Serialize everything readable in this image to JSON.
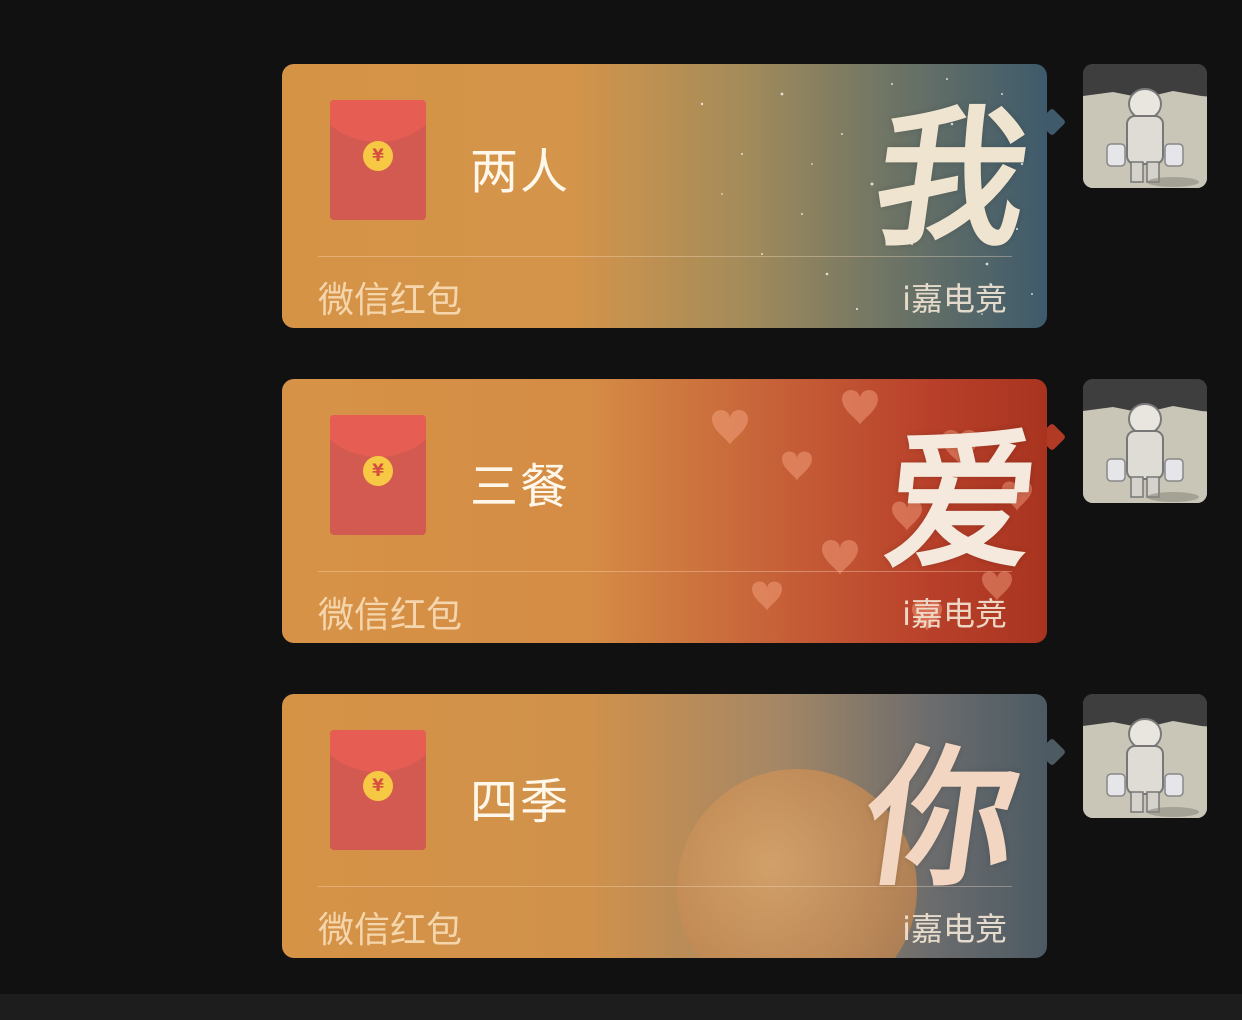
{
  "messages": [
    {
      "title": "两人",
      "footer_label": "微信红包",
      "brand": "i嘉电竞",
      "calligraphy": "我",
      "coin_symbol": "¥",
      "theme": "starry-sky",
      "accent": "#d59346"
    },
    {
      "title": "三餐",
      "footer_label": "微信红包",
      "brand": "i嘉电竞",
      "calligraphy": "爱",
      "coin_symbol": "¥",
      "theme": "hearts-bokeh",
      "accent": "#c44a2e"
    },
    {
      "title": "四季",
      "footer_label": "微信红包",
      "brand": "i嘉电竞",
      "calligraphy": "你",
      "coin_symbol": "¥",
      "theme": "moon",
      "accent": "#4c5a63"
    }
  ],
  "avatar_icon": "astronaut-avatar"
}
